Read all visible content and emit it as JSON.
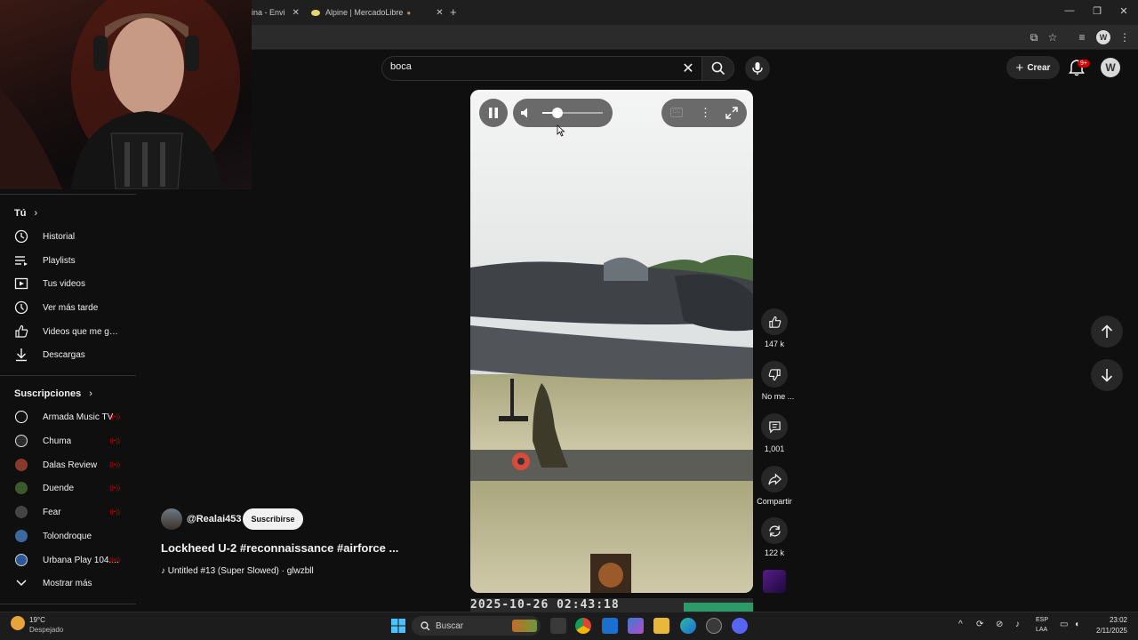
{
  "browser": {
    "tabs": [
      {
        "label": "ina - Envi"
      },
      {
        "label": "Alpine | MercadoLibre"
      }
    ],
    "new_tab": "+",
    "close": "✕"
  },
  "header": {
    "search_query": "boca",
    "create_label": "Crear",
    "notifications_badge": "9+"
  },
  "sidebar": {
    "you_title": "Tú",
    "you_items": [
      {
        "label": "Historial",
        "icon": "history-icon"
      },
      {
        "label": "Playlists",
        "icon": "playlists-icon"
      },
      {
        "label": "Tus videos",
        "icon": "your-videos-icon"
      },
      {
        "label": "Ver más tarde",
        "icon": "watch-later-icon"
      },
      {
        "label": "Videos que me gus...",
        "icon": "liked-icon"
      },
      {
        "label": "Descargas",
        "icon": "download-icon"
      }
    ],
    "subs_title": "Suscripciones",
    "subscriptions": [
      {
        "label": "Armada Music TV",
        "color": "#111111"
      },
      {
        "label": "Chuma",
        "color": "#2c2c2c"
      },
      {
        "label": "Dalas Review",
        "color": "#8a3a2a"
      },
      {
        "label": "Duende",
        "color": "#3a5a2a"
      },
      {
        "label": "Fear",
        "color": "#444444"
      },
      {
        "label": "Tolondroque",
        "color": "#3a6aa0"
      },
      {
        "label": "Urbana Play 104....",
        "color": "#2a5a9a"
      }
    ],
    "show_more": "Mostrar más"
  },
  "actions": {
    "likes": "147 k",
    "dislike": "No me ...",
    "comments": "1,001",
    "share": "Compartir",
    "remix": "122 k"
  },
  "video": {
    "channel": "@Realai453",
    "subscribe": "Suscribirse",
    "title": "Lockheed U-2 #reconnaissance #airforce ...",
    "music": "♪ Untitled #13 (Super Slowed) · glwzbll",
    "timestamp": "2025-10-26 02:43:18",
    "volume_level": 0.25
  },
  "taskbar": {
    "weather_temp": "19°C",
    "weather_desc": "Despejado",
    "search_placeholder": "Buscar",
    "lang_top": "ESP",
    "lang_bottom": "LAA",
    "time": "23:02",
    "date": "2/11/2025"
  }
}
